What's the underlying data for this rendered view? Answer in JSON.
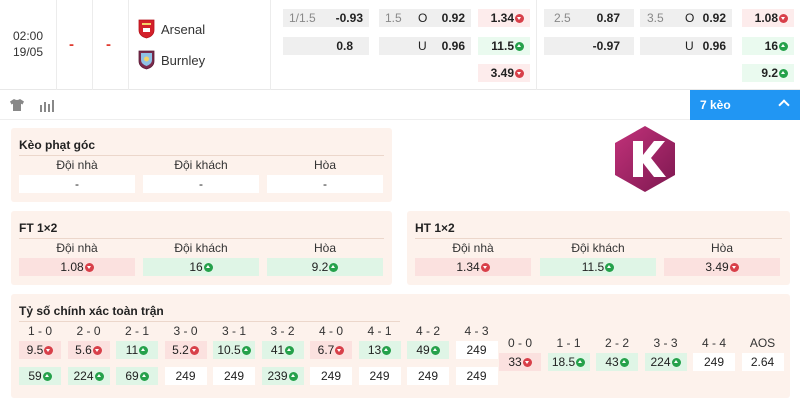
{
  "match": {
    "time": "02:00",
    "date": "19/05",
    "score_home": "-",
    "score_away": "-",
    "home_team": "Arsenal",
    "away_team": "Burnley"
  },
  "odds": {
    "hdp_ft": {
      "line": "1/1.5",
      "home": "-0.93",
      "away": "0.8"
    },
    "ou_ft": {
      "line": "1.5",
      "over_label": "O",
      "over": "0.92",
      "under_label": "U",
      "under": "0.96"
    },
    "x12_ft": {
      "home": "1.34",
      "away": "11.5",
      "draw": "3.49"
    },
    "hdp_h1": {
      "line": "2.5",
      "home": "0.87",
      "away": "-0.97"
    },
    "ou_h1": {
      "line": "3.5",
      "over_label": "O",
      "over": "0.92",
      "under_label": "U",
      "under": "0.96"
    },
    "x12_h1": {
      "home": "1.08",
      "away": "16",
      "draw": "9.2"
    }
  },
  "toolbar": {
    "more_label": "7 kèo"
  },
  "corner": {
    "title": "Kèo phạt góc",
    "headers": [
      "Đội nhà",
      "Đội khách",
      "Hòa"
    ],
    "values": [
      "-",
      "-",
      "-"
    ]
  },
  "ft": {
    "title": "FT 1×2",
    "headers": [
      "Đội nhà",
      "Đội khách",
      "Hòa"
    ],
    "values": [
      "1.08",
      "16",
      "9.2"
    ]
  },
  "ht": {
    "title": "HT 1×2",
    "headers": [
      "Đội nhà",
      "Đội khách",
      "Hòa"
    ],
    "values": [
      "1.34",
      "11.5",
      "3.49"
    ]
  },
  "correct_score": {
    "title": "Tỷ số chính xác toàn trận",
    "home_win": {
      "labels": [
        "1 - 0",
        "2 - 0",
        "2 - 1",
        "3 - 0",
        "3 - 1",
        "3 - 2",
        "4 - 0",
        "4 - 1",
        "4 - 2",
        "4 - 3"
      ],
      "home_values": [
        "9.5",
        "5.6",
        "11",
        "5.2",
        "10.5",
        "41",
        "6.7",
        "13",
        "49",
        "249"
      ],
      "away_values": [
        "59",
        "224",
        "69",
        "249",
        "249",
        "239",
        "249",
        "249",
        "249",
        "249"
      ]
    },
    "draw": {
      "labels": [
        "0 - 0",
        "1 - 1",
        "2 - 2",
        "3 - 3",
        "4 - 4",
        "AOS"
      ],
      "values": [
        "33",
        "18.5",
        "43",
        "224",
        "249",
        "2.64"
      ]
    }
  },
  "colors": {
    "accent": "#2196f3",
    "score": "#e03c31",
    "down": "#d8404a",
    "up": "#25a14b",
    "panel": "#fdf2ec"
  }
}
